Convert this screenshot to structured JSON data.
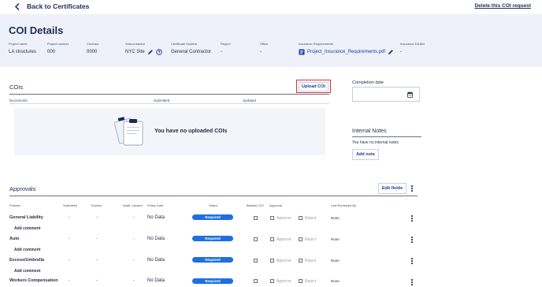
{
  "nav": {
    "back_label": "Back to Certificates",
    "delete_label": "Delete this COI request"
  },
  "header": {
    "title": "COI Details",
    "fields": [
      {
        "label": "Project name",
        "value": "LA structures"
      },
      {
        "label": "Project number",
        "value": "000"
      },
      {
        "label": "Contract",
        "value": "0000"
      },
      {
        "label": "Subcontractor",
        "value": "NYC Site"
      },
      {
        "label": "Certificate Holders",
        "value": "General Contractor"
      },
      {
        "label": "Region",
        "value": "-"
      },
      {
        "label": "Office",
        "value": "-"
      },
      {
        "label": "Insurance Requirements",
        "value": "Project_Insurance_Requirements.pdf"
      },
      {
        "label": "Insurance Exhibit",
        "value": "-"
      }
    ]
  },
  "cois": {
    "title": "COIs",
    "upload_label": "Upload COI",
    "columns": [
      "Documents",
      "Submitted",
      "Updated"
    ],
    "empty_text": "You have no uploaded COIs"
  },
  "completion": {
    "label": "Completion date"
  },
  "notes": {
    "title": "Internal Notes",
    "empty_text": "You have no internal notes",
    "add_label": "Add note"
  },
  "approvals": {
    "title": "Approvals",
    "edit_label": "Edit fields",
    "columns": [
      "Policies",
      "Submitted",
      "Expires",
      "Addtl. Insured",
      "Policy Limit",
      "Status",
      "Blanket COI",
      "Approval",
      "Last Reviewed By"
    ],
    "approve_label": "Approve",
    "reject_label": "Reject",
    "comment_label": "Add comment",
    "rows": [
      {
        "policy": "General Liability",
        "submitted": "-",
        "expires": "-",
        "addtl": "-",
        "limit": "No Data",
        "status": "Required",
        "reviewed": "None"
      },
      {
        "policy": "Auto",
        "submitted": "-",
        "expires": "-",
        "addtl": "-",
        "limit": "No Data",
        "status": "Required",
        "reviewed": "None"
      },
      {
        "policy": "Excess/Umbrella",
        "submitted": "-",
        "expires": "-",
        "addtl": "-",
        "limit": "No Data",
        "status": "Required",
        "reviewed": "None"
      },
      {
        "policy": "Workers Compensation",
        "submitted": "-",
        "expires": "-",
        "addtl": "-",
        "limit": "No Data",
        "status": "Required",
        "reviewed": "None"
      }
    ]
  },
  "colors": {
    "accent": "#1e3a9b",
    "status_required": "#1e6fe0",
    "header_bg": "#eef1fa",
    "highlight": "#d32f3a"
  }
}
